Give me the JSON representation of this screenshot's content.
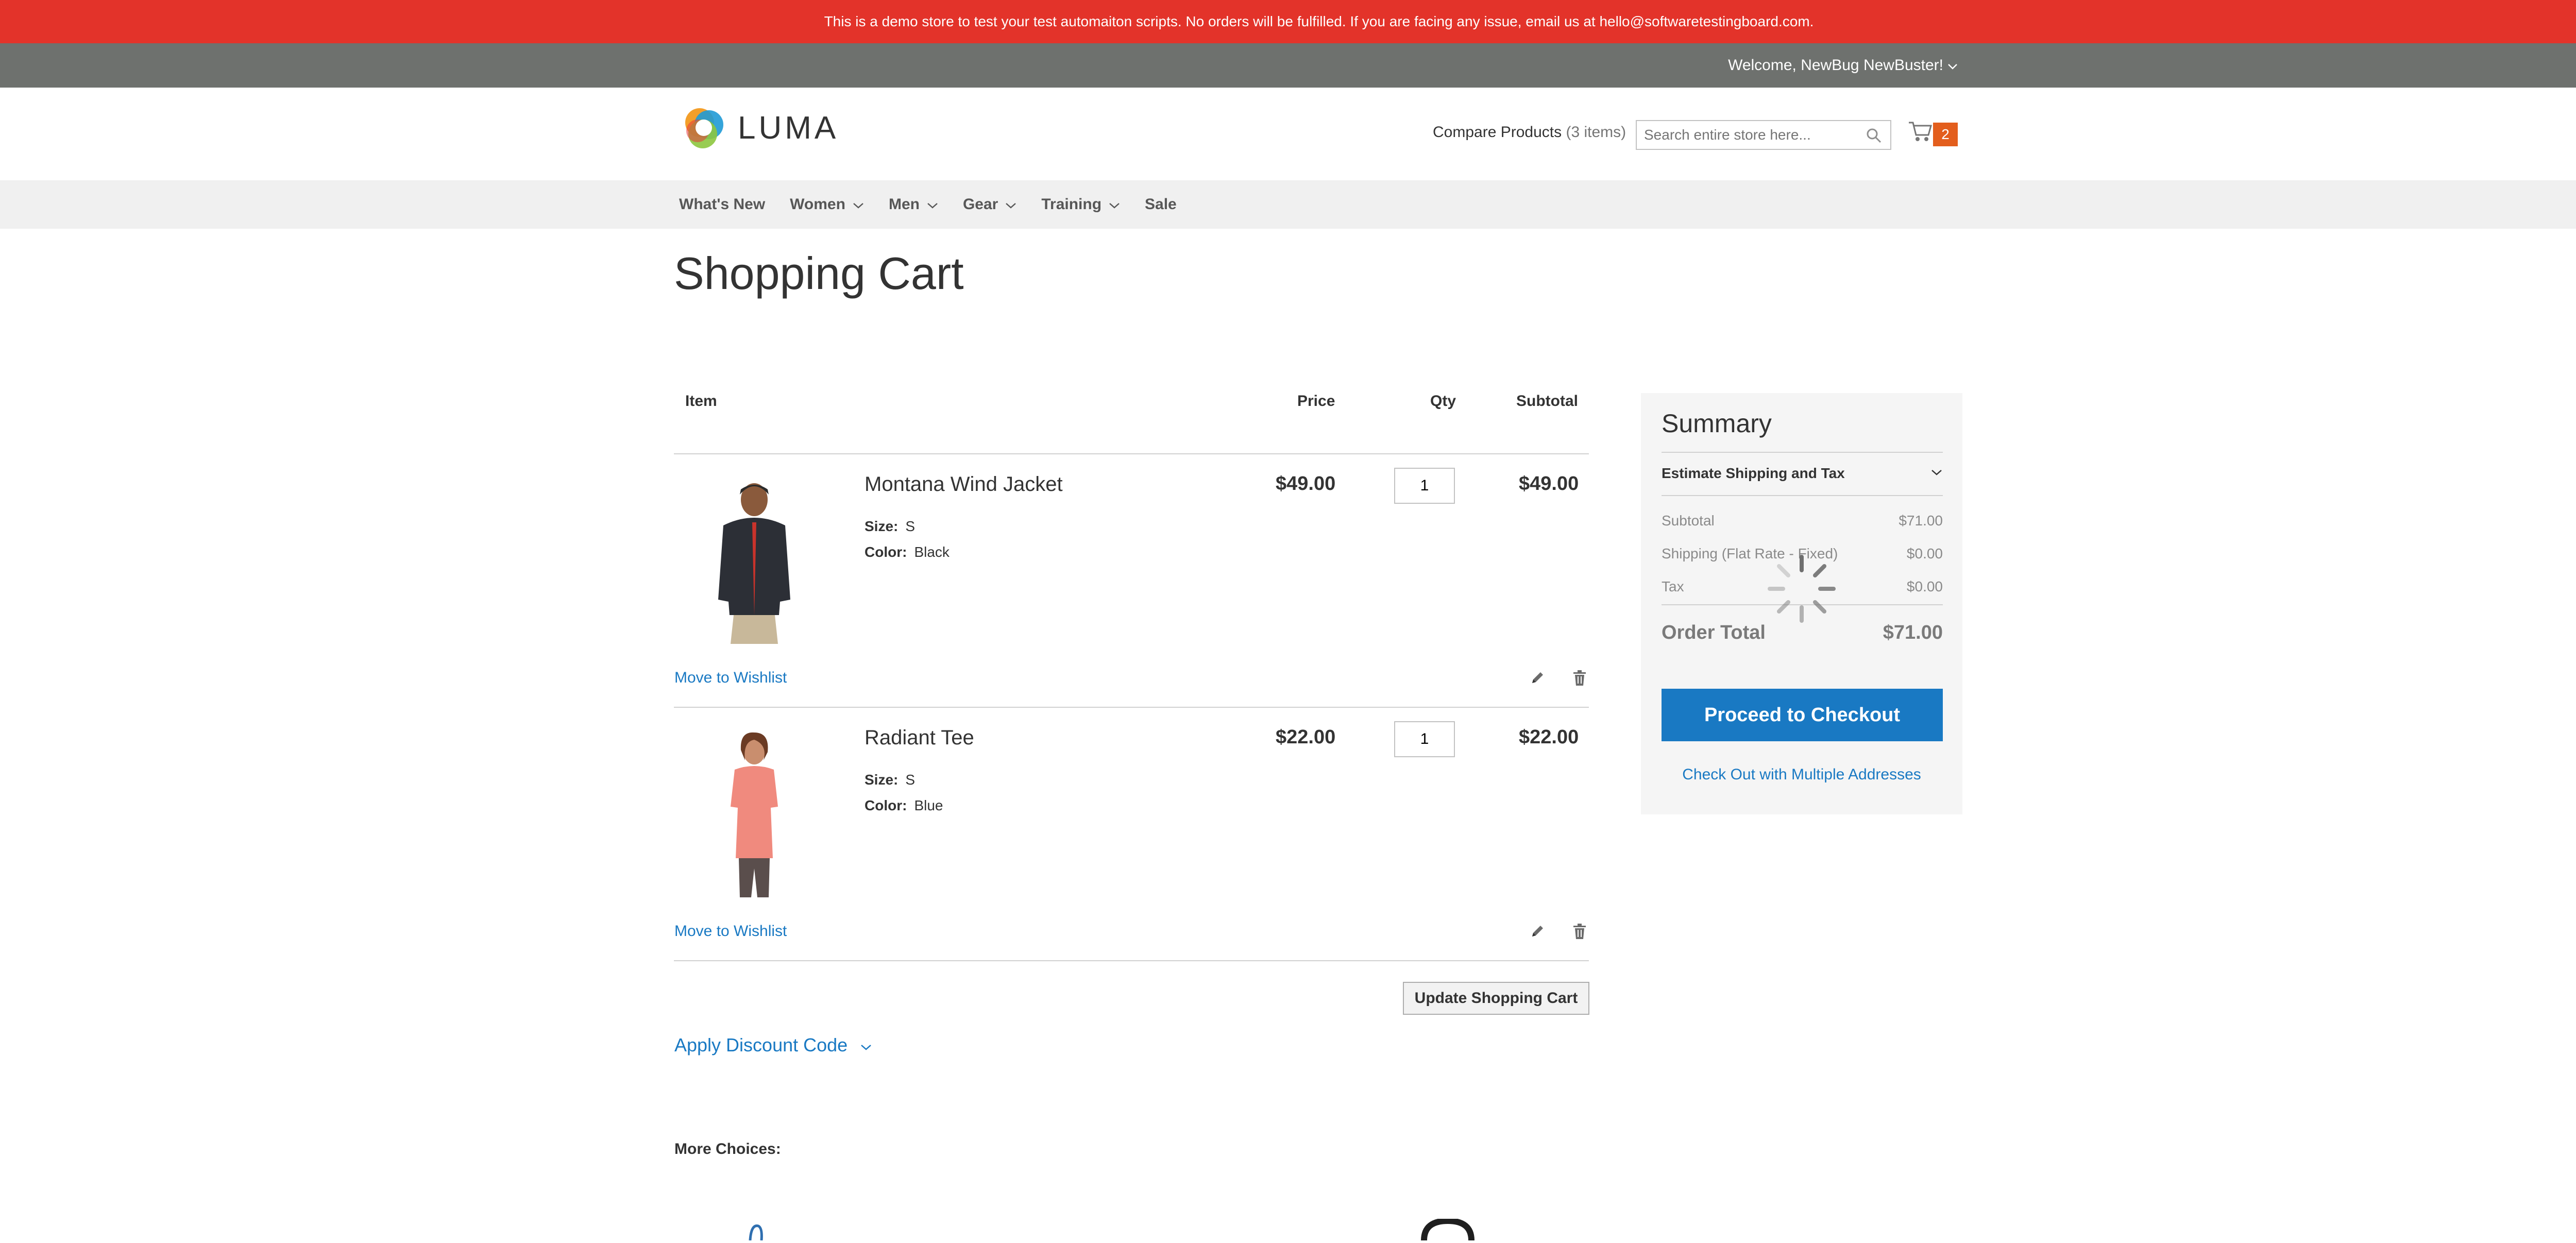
{
  "banner": {
    "text": "This is a demo store to test your test automaiton scripts. No orders will be fulfilled. If you are facing any issue, email us at hello@softwaretestingboard.com."
  },
  "account": {
    "welcome": "Welcome, NewBug NewBuster!"
  },
  "logo": {
    "text": "LUMA"
  },
  "compare": {
    "label": "Compare Products",
    "count": "(3 items)"
  },
  "search": {
    "placeholder": "Search entire store here..."
  },
  "minicart": {
    "count": "2"
  },
  "nav": {
    "items": [
      {
        "label": "What's New"
      },
      {
        "label": "Women"
      },
      {
        "label": "Men"
      },
      {
        "label": "Gear"
      },
      {
        "label": "Training"
      },
      {
        "label": "Sale"
      }
    ]
  },
  "page": {
    "title": "Shopping Cart"
  },
  "table": {
    "headers": {
      "item": "Item",
      "price": "Price",
      "qty": "Qty",
      "subtotal": "Subtotal"
    },
    "rows": [
      {
        "name": "Montana Wind Jacket",
        "size_label": "Size:",
        "size": "S",
        "color_label": "Color:",
        "color": "Black",
        "price": "$49.00",
        "qty": "1",
        "subtotal": "$49.00",
        "wishlist": "Move to Wishlist"
      },
      {
        "name": "Radiant Tee",
        "size_label": "Size:",
        "size": "S",
        "color_label": "Color:",
        "color": "Blue",
        "price": "$22.00",
        "qty": "1",
        "subtotal": "$22.00",
        "wishlist": "Move to Wishlist"
      }
    ],
    "update_label": "Update Shopping Cart"
  },
  "discount": {
    "label": "Apply Discount Code"
  },
  "more_choices": {
    "label": "More Choices:"
  },
  "summary": {
    "title": "Summary",
    "estimate": "Estimate Shipping and Tax",
    "subtotal_label": "Subtotal",
    "subtotal": "$71.00",
    "shipping_label": "Shipping (Flat Rate - Fixed)",
    "shipping": "$0.00",
    "tax_label": "Tax",
    "tax": "$0.00",
    "total_label": "Order Total",
    "total": "$71.00",
    "checkout_label": "Proceed to Checkout",
    "multi_label": "Check Out with Multiple Addresses"
  },
  "colors": {
    "banner": "#e3332a",
    "welcome_bar": "#6e716e",
    "accent": "#1979c3",
    "cart_badge": "#e35e1d"
  }
}
